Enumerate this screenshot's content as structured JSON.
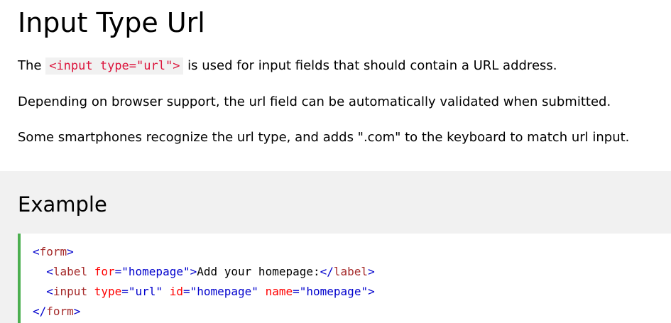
{
  "page": {
    "title": "Input Type Url"
  },
  "paragraphs": {
    "p1_before": "The ",
    "p1_code": "<input type=\"url\">",
    "p1_after": " is used for input fields that should contain a URL address.",
    "p2": "Depending on browser support, the url field can be automatically validated when submitted.",
    "p3": "Some smartphones recognize the url type, and adds \".com\" to the keyboard to match url input."
  },
  "example": {
    "heading": "Example",
    "code": {
      "line1": {
        "open": "<",
        "tag": "form",
        "close": ">"
      },
      "line2": {
        "indent": "  ",
        "open": "<",
        "tag": "label",
        "space": " ",
        "attr1": "for",
        "eq1": "=",
        "val1": "\"homepage\"",
        "close": ">",
        "text": "Add your homepage:",
        "end_open": "</",
        "end_tag": "label",
        "end_close": ">"
      },
      "line3": {
        "indent": "  ",
        "open": "<",
        "tag": "input",
        "space1": " ",
        "attr1": "type",
        "eq1": "=",
        "val1": "\"url\"",
        "space2": " ",
        "attr2": "id",
        "eq2": "=",
        "val2": "\"homepage\"",
        "space3": " ",
        "attr3": "name",
        "eq3": "=",
        "val3": "\"homepage\"",
        "close": ">"
      },
      "line4": {
        "open": "</",
        "tag": "form",
        "close": ">"
      }
    }
  },
  "colors": {
    "inline_code_text": "#dc143c",
    "inline_code_bg": "#f1f1f1",
    "panel_bg": "#f1f1f1",
    "code_border": "#4caf50",
    "tag_name": "#a52a2a",
    "bracket": "#0000cd",
    "attribute": "#ff0000",
    "attribute_value": "#0000cd"
  }
}
